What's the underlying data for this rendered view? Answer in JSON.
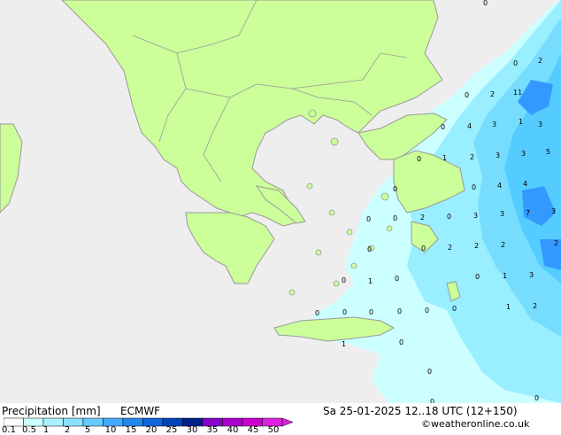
{
  "title": {
    "variable": "Precipitation [mm]",
    "model": "ECMWF",
    "datetime": "Sa 25-01-2025 12..18 UTC (12+150)",
    "credit": "©weatheronline.co.uk"
  },
  "colors": {
    "sea": "#eeeeee",
    "land": "#ccff99",
    "coast": "#999999",
    "border": "#999999",
    "precip": [
      "#ccffff",
      "#99eeff",
      "#77ddff",
      "#55ccff",
      "#3399ff",
      "#1166ee",
      "#0044cc"
    ]
  },
  "legend": {
    "ticks": [
      "0.1",
      "0.5",
      "1",
      "2",
      "5",
      "10",
      "15",
      "20",
      "25",
      "30",
      "35",
      "40",
      "45",
      "50"
    ],
    "colors": [
      "#ffffff",
      "#ccffff",
      "#aaf0ff",
      "#88e0ff",
      "#66ccff",
      "#44aaff",
      "#2288ee",
      "#1166dd",
      "#0044bb",
      "#002288",
      "#8800cc",
      "#aa00cc",
      "#cc00cc",
      "#dd22dd"
    ]
  },
  "map_labels": [
    {
      "text": "0"
    },
    {
      "text": "0"
    },
    {
      "text": "2"
    },
    {
      "text": "2"
    },
    {
      "text": "11"
    },
    {
      "text": "0"
    },
    {
      "text": "4"
    },
    {
      "text": "3"
    },
    {
      "text": "3"
    },
    {
      "text": "1"
    },
    {
      "text": "0"
    },
    {
      "text": "0"
    },
    {
      "text": "1"
    },
    {
      "text": "2"
    },
    {
      "text": "3"
    },
    {
      "text": "3"
    },
    {
      "text": "5"
    },
    {
      "text": "0"
    },
    {
      "text": "0"
    },
    {
      "text": "4"
    },
    {
      "text": "4"
    },
    {
      "text": "0"
    },
    {
      "text": "0"
    },
    {
      "text": "2"
    },
    {
      "text": "0"
    },
    {
      "text": "3"
    },
    {
      "text": "3"
    },
    {
      "text": "7"
    },
    {
      "text": "3"
    },
    {
      "text": "0"
    },
    {
      "text": "0"
    },
    {
      "text": "2"
    },
    {
      "text": "2"
    },
    {
      "text": "2"
    },
    {
      "text": "2"
    },
    {
      "text": "0"
    },
    {
      "text": "0"
    },
    {
      "text": "0"
    },
    {
      "text": "1"
    },
    {
      "text": "3"
    },
    {
      "text": "1"
    },
    {
      "text": "0"
    },
    {
      "text": "0"
    },
    {
      "text": "0"
    },
    {
      "text": "0"
    },
    {
      "text": "0"
    },
    {
      "text": "0"
    },
    {
      "text": "1"
    },
    {
      "text": "2"
    },
    {
      "text": "1"
    },
    {
      "text": "0"
    },
    {
      "text": "0"
    },
    {
      "text": "0"
    },
    {
      "text": "0"
    }
  ]
}
